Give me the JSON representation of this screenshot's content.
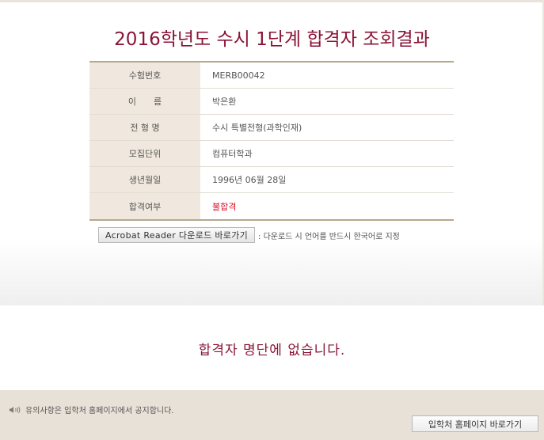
{
  "header": {
    "title": "2016학년도 수시 1단계 합격자 조회결과"
  },
  "info": [
    {
      "label": "수험번호",
      "value": "MERB00042"
    },
    {
      "label": "이　　름",
      "value": "박은환"
    },
    {
      "label": "전 형 명",
      "value": "수시 특별전형(과학인재)"
    },
    {
      "label": "모집단위",
      "value": "컴퓨터학과"
    },
    {
      "label": "생년월일",
      "value": "1996년 06월 28일"
    },
    {
      "label": "합격여부",
      "value": "불합격"
    }
  ],
  "download": {
    "button_label": "Acrobat Reader 다운로드 바로가기",
    "note": ": 다운로드 시 언어를 반드시 한국어로 지정"
  },
  "result": {
    "message": "합격자 명단에 없습니다."
  },
  "footer": {
    "notice": "유의사항은 입학처 홈페이지에서 공지합니다.",
    "home_button_label": "입학처 홈페이지 바로가기"
  },
  "colors": {
    "accent": "#8a1436",
    "fail": "#d4142a",
    "table_header_bg": "#f0e8de",
    "footer_bg": "#e8e1d8"
  },
  "icons": {
    "notice_icon": "speaker-icon"
  }
}
